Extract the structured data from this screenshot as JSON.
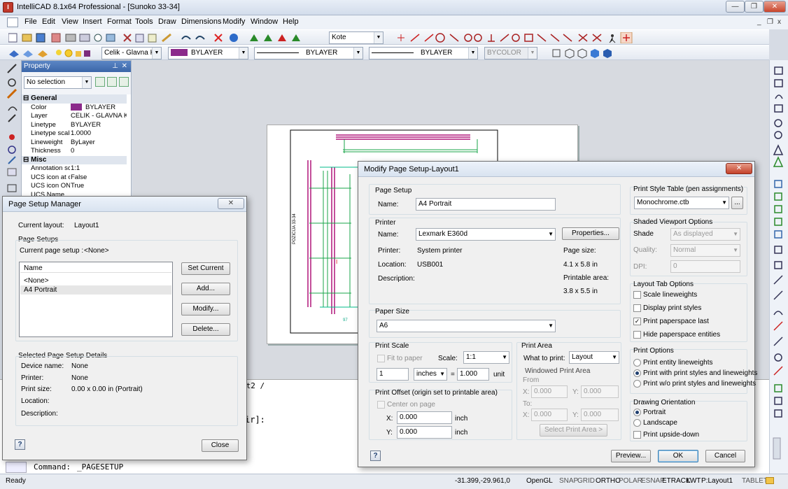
{
  "app": {
    "title": "IntelliCAD 8.1x64 Professional  - [Sunoko 33-34]"
  },
  "window_controls": {
    "minimize": "—",
    "restore": "❐",
    "close": "✕",
    "mdi_min": "_",
    "mdi_restore": "❐",
    "mdi_close": "x"
  },
  "menu": [
    "File",
    "Edit",
    "View",
    "Insert",
    "Format",
    "Tools",
    "Draw",
    "Dimensions",
    "Modify",
    "Window",
    "Help"
  ],
  "toolbar": {
    "kote_combo": "Kote",
    "layer_combo": "Celik - Glavna Kja",
    "color_combo": "BYLAYER",
    "linetype_combo": "BYLAYER",
    "lineweight_combo": "BYLAYER",
    "plotstyle_combo": "BYCOLOR",
    "color_swatch": "#8b2a8b"
  },
  "property_panel": {
    "title": "Property",
    "selection": "No selection",
    "categories": [
      {
        "name": "General",
        "rows": [
          {
            "k": "Color",
            "v": "BYLAYER"
          },
          {
            "k": "Layer",
            "v": "CELIK - GLAVNA KJA"
          },
          {
            "k": "Linetype",
            "v": "BYLAYER"
          },
          {
            "k": "Linetype scale",
            "v": "1.0000"
          },
          {
            "k": "Lineweight",
            "v": "ByLayer"
          },
          {
            "k": "Thickness",
            "v": "0"
          }
        ]
      },
      {
        "name": "Misc",
        "rows": [
          {
            "k": "Annotation sc",
            "v": "1:1"
          },
          {
            "k": "UCS icon at o",
            "v": "False"
          },
          {
            "k": "UCS icon ON",
            "v": "True"
          },
          {
            "k": "UCS Name",
            "v": ""
          }
        ]
      }
    ]
  },
  "page_setup_manager": {
    "title": "Page Setup Manager",
    "current_layout_label": "Current layout:",
    "current_layout_value": "Layout1",
    "page_setups_label": "Page Setups",
    "current_page_setup_label": "Current page setup :",
    "current_page_setup_value": "<None>",
    "list_header": "Name",
    "list_items": [
      "<None>",
      "A4 Portrait"
    ],
    "buttons": {
      "set_current": "Set Current",
      "add": "Add...",
      "modify": "Modify...",
      "delete": "Delete...",
      "close": "Close"
    },
    "details_label": "Selected Page Setup Details",
    "details": [
      {
        "k": "Device name:",
        "v": "None"
      },
      {
        "k": "Printer:",
        "v": "None"
      },
      {
        "k": "Print size:",
        "v": "0.00 x 0.00 in (Portrait)"
      },
      {
        "k": "Location:",
        "v": ""
      },
      {
        "k": "Description:",
        "v": ""
      }
    ]
  },
  "modify_page_setup": {
    "title": "Modify Page Setup-Layout1",
    "page_setup": {
      "group": "Page Setup",
      "name_label": "Name:",
      "name_value": "A4 Portrait"
    },
    "printer": {
      "group": "Printer",
      "name_label": "Name:",
      "name_value": "Lexmark E360d",
      "properties_btn": "Properties...",
      "printer_label": "Printer:",
      "printer_value": "System printer",
      "location_label": "Location:",
      "location_value": "USB001",
      "description_label": "Description:",
      "page_size_label": "Page size:",
      "page_size_value": "4.1 x 5.8 in",
      "printable_area_label": "Printable area:",
      "printable_area_value": "3.8 x 5.5 in"
    },
    "paper_size": {
      "group": "Paper Size",
      "value": "A6"
    },
    "print_scale": {
      "group": "Print Scale",
      "fit_to_paper": "Fit to paper",
      "scale_label": "Scale:",
      "scale_value": "1:1",
      "num": "1",
      "units": "inches",
      "equals": "=",
      "unit_value": "1.000",
      "unit_label": "unit"
    },
    "print_offset": {
      "group": "Print Offset (origin set to printable area)",
      "center": "Center on page",
      "x_label": "X:",
      "x_value": "0.000",
      "y_label": "Y:",
      "y_value": "0.000",
      "unit": "inch"
    },
    "print_area": {
      "group": "Print Area",
      "what_label": "What to print:",
      "what_value": "Layout",
      "windowed": "Windowed Print Area",
      "from": "From",
      "to": "To:",
      "x": "X:",
      "y": "Y:",
      "zero": "0.000",
      "select_btn": "Select Print Area >"
    },
    "print_style": {
      "group": "Print Style Table (pen assignments)",
      "value": "Monochrome.ctb",
      "browse": "..."
    },
    "shaded": {
      "group": "Shaded Viewport Options",
      "shade_label": "Shade",
      "shade_value": "As displayed",
      "quality_label": "Quality:",
      "quality_value": "Normal",
      "dpi_label": "DPI:",
      "dpi_value": "0"
    },
    "layout_tab": {
      "group": "Layout Tab Options",
      "options": [
        {
          "label": "Scale lineweights",
          "checked": false
        },
        {
          "label": "Display print styles",
          "checked": false
        },
        {
          "label": "Print paperspace last",
          "checked": true
        },
        {
          "label": "Hide paperspace entities",
          "checked": false
        }
      ]
    },
    "print_options": {
      "group": "Print Options",
      "options": [
        {
          "label": "Print entity lineweights",
          "on": false
        },
        {
          "label": "Print with print styles and lineweights",
          "on": true
        },
        {
          "label": "Print w/o print styles and lineweights",
          "on": false
        }
      ]
    },
    "orientation": {
      "group": "Drawing Orientation",
      "portrait": "Portrait",
      "landscape": "Landscape",
      "upside": "Print upside-down"
    },
    "buttons": {
      "help": "?",
      "preview": "Preview...",
      "ok": "OK",
      "cancel": "Cancel"
    }
  },
  "drawing": {
    "tab_fragment": "ut2 /",
    "cmd_fragment": "ir]:"
  },
  "command": {
    "prompt": "Command:",
    "text": "_PAGESETUP"
  },
  "status": {
    "ready": "Ready",
    "coords": "-31.399,-29.961,0",
    "items": [
      "OpenGL",
      "SNAP",
      "GRID",
      "ORTHO",
      "POLAR",
      "ESNAP",
      "ETRACK",
      "LWT",
      "P:Layout1",
      "TABLET"
    ]
  }
}
